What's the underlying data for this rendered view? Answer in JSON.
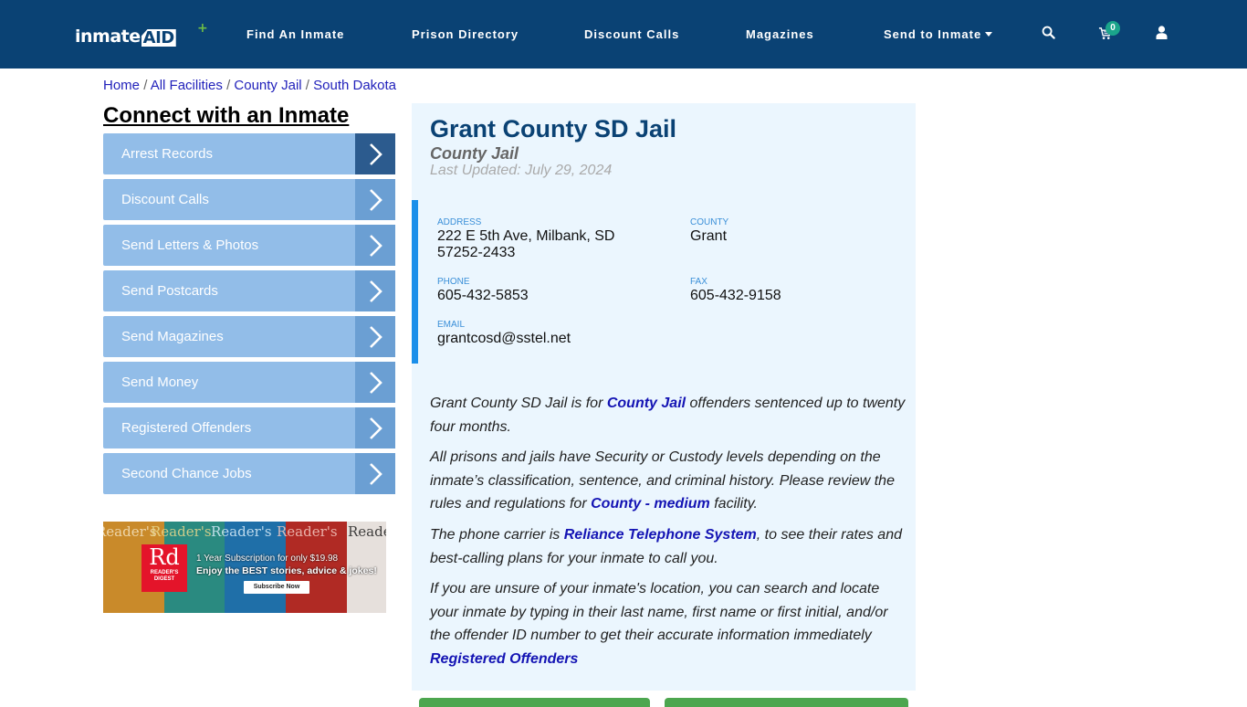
{
  "navbar": {
    "logo": {
      "part1": "inmate",
      "part2": "AID",
      "plus": "+"
    },
    "links": [
      {
        "label": "Find An Inmate"
      },
      {
        "label": "Prison Directory"
      },
      {
        "label": "Discount Calls"
      },
      {
        "label": "Magazines"
      },
      {
        "label": "Send to Inmate",
        "has_dropdown": true
      }
    ],
    "icons": {
      "search": "search-icon",
      "cart": "cart-icon",
      "user": "user-icon"
    },
    "cart_count": "0"
  },
  "breadcrumb": {
    "items": [
      "Home",
      "All Facilities",
      "County Jail",
      "South Dakota"
    ],
    "separator": "/"
  },
  "sidebar": {
    "title": "Connect with an Inmate",
    "items": [
      {
        "label": "Arrest Records",
        "active": true
      },
      {
        "label": "Discount Calls"
      },
      {
        "label": "Send Letters & Photos"
      },
      {
        "label": "Send Postcards"
      },
      {
        "label": "Send Magazines"
      },
      {
        "label": "Send Money"
      },
      {
        "label": "Registered Offenders"
      },
      {
        "label": "Second Chance Jobs"
      }
    ],
    "ad": {
      "logo": "Rd",
      "logo_sub1": "READER'S",
      "logo_sub2": "DIGEST",
      "line1": "1 Year Subscription for only $19.98",
      "line2": "Enjoy the BEST stories, advice & jokes!",
      "cta": "Subscribe Now",
      "cover_title": "Reader's"
    }
  },
  "facility": {
    "name": "Grant County SD Jail",
    "type": "County Jail",
    "last_updated": "Last Updated: July 29, 2024",
    "address_label": "ADDRESS",
    "address_line1": "222 E 5th Ave, Milbank, SD",
    "address_line2": "57252-2433",
    "county_label": "COUNTY",
    "county": "Grant",
    "phone_label": "PHONE",
    "phone": "605-432-5853",
    "fax_label": "FAX",
    "fax": "605-432-9158",
    "email_label": "EMAIL",
    "email": "grantcosd@sstel.net"
  },
  "description": {
    "p1_a": "Grant County SD Jail is for ",
    "p1_link": "County Jail",
    "p1_b": " offenders sentenced up to twenty four months.",
    "p2_a": "All prisons and jails have Security or Custody levels depending on the inmate’s classification, sentence, and criminal history. Please review the rules and regulations for ",
    "p2_link": "County - medium",
    "p2_b": " facility.",
    "p3_a": "The phone carrier is ",
    "p3_link": "Reliance Telephone System",
    "p3_b": ", to see their rates and best-calling plans for your inmate to call you.",
    "p4": "If you are unsure of your inmate's location, you can search and locate your inmate by typing in their last name, first name or first initial, and/or the offender ID number to get their accurate information immediately",
    "p4_link": "Registered Offenders"
  },
  "colors": {
    "navbar_bg": "#0a4274",
    "accent_blue": "#1b8fea",
    "sidebar_item": "#92bde8",
    "sidebar_arrow": "#6b9fd3",
    "sidebar_arrow_active": "#2c5b8e",
    "panel_bg": "#ebf6fe",
    "link": "#1414b4",
    "cart_badge": "#1aa58b",
    "green_button": "#4ca64f"
  }
}
